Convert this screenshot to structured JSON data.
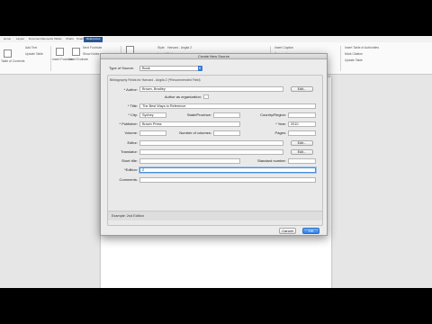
{
  "ribbon": {
    "tabs": [
      "Home",
      "Layout",
      "Document Elements",
      "Tables",
      "Charts",
      "SmartArt",
      "Review",
      "References"
    ],
    "active_tab_index": 7,
    "items": {
      "table_of_contents": "Table of Contents",
      "add_text": "Add Text",
      "update_table": "Update Table",
      "insert_footnote": "Insert Footnote",
      "insert_endnote": "Insert Endnote",
      "next_footnote": "Next Footnote",
      "show_notes": "Show Notes",
      "manage_sources": "Manage Sources",
      "style_label": "Style:",
      "style_value": "Harvard - Anglia 2",
      "insert_citation": "Insert Citation",
      "insert_caption": "Insert Caption",
      "cross_reference": "Cross-reference",
      "insert_toa": "Insert Table of Authorities",
      "mark_citation": "Mark Citation",
      "update_table_2": "Update Table"
    }
  },
  "dialog": {
    "title": "Create New Source",
    "type_of_source_label": "Type of Source:",
    "type_of_source_value": "Book",
    "group_title": "Bibliography Fields for Harvard - Anglia 2 (*Recommended Field)",
    "fields": {
      "author_label": "* Author:",
      "author_value": "Brown, Bradley",
      "author_org_label": "Author as organization:",
      "title_label": "* Title:",
      "title_value": "The Best Ways to Reference",
      "city_label": "* City:",
      "city_value": "Sydney",
      "state_label": "State/Province:",
      "state_value": "",
      "country_label": "Country/Region:",
      "country_value": "",
      "publisher_label": "* Publisher:",
      "publisher_value": "Brown Press",
      "year_label": "* Year:",
      "year_value": "2010",
      "volume_label": "Volume:",
      "num_volumes_label": "Number of volumes:",
      "pages_label": "Pages:",
      "editor_label": "Editor:",
      "translator_label": "Translator:",
      "short_title_label": "Short title:",
      "standard_number_label": "Standard number:",
      "edition_label": "*Edition:",
      "edition_value": "2",
      "comments_label": "Comments:"
    },
    "edit_label": "Edit...",
    "example_text": "Example: 2nd Edition",
    "cancel_label": "Cancel",
    "ok_label": "OK"
  }
}
